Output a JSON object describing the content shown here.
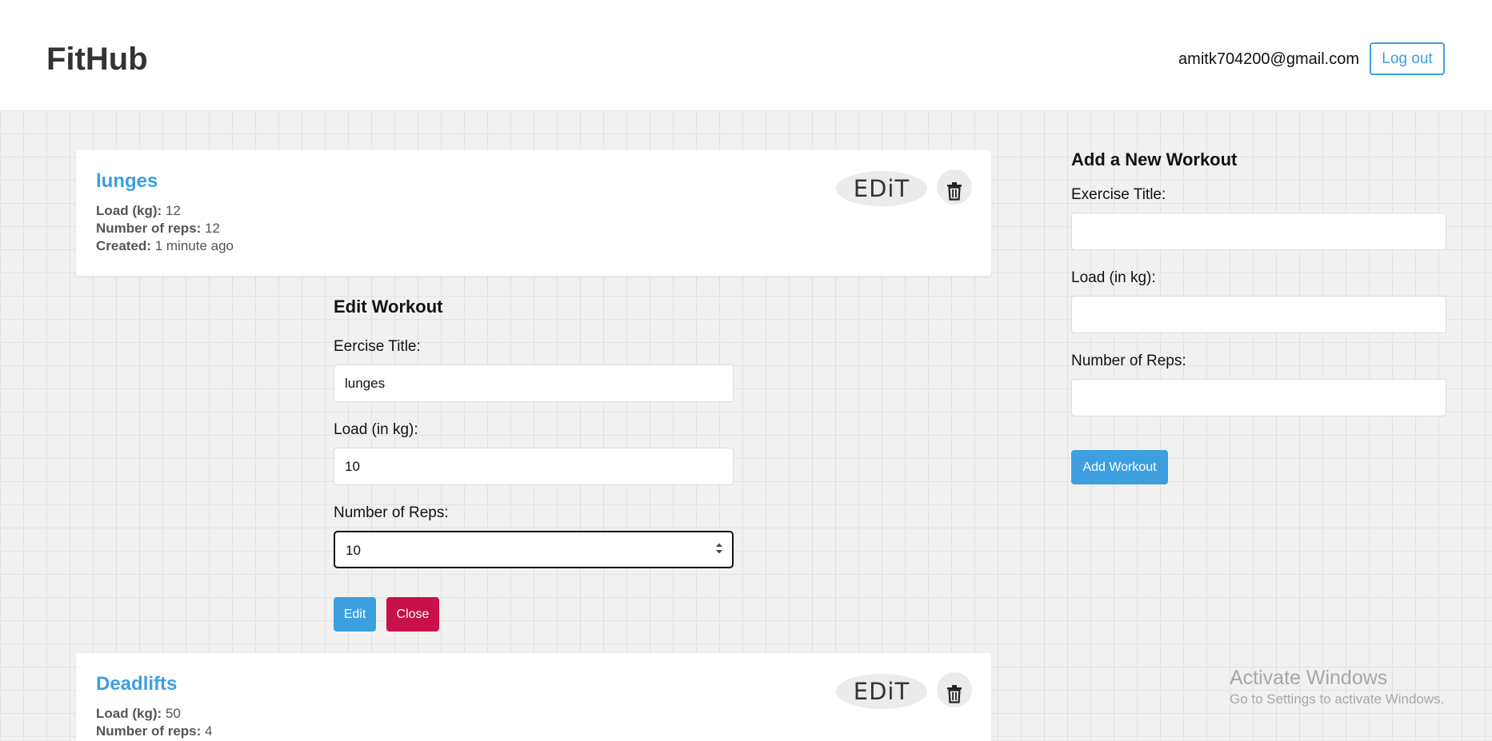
{
  "app": {
    "logo": "FitHub"
  },
  "header": {
    "user_email": "amitk704200@gmail.com",
    "logout_label": "Log out"
  },
  "workouts": [
    {
      "title": "lunges",
      "load_label": "Load (kg):",
      "load_value": "12",
      "reps_label": "Number of reps:",
      "reps_value": "12",
      "created_label": "Created:",
      "created_value": "1 minute ago",
      "edit_label": "EDiT"
    },
    {
      "title": "Deadlifts",
      "load_label": "Load (kg):",
      "load_value": "50",
      "reps_label": "Number of reps:",
      "reps_value": "4",
      "edit_label": "EDiT"
    }
  ],
  "edit_form": {
    "heading": "Edit Workout",
    "title_label": "Eercise Title:",
    "title_value": "lunges",
    "load_label": "Load (in kg):",
    "load_value": "10",
    "reps_label": "Number of Reps:",
    "reps_value": "10",
    "submit_label": "Edit",
    "close_label": "Close"
  },
  "add_form": {
    "heading": "Add a New Workout",
    "title_label": "Exercise Title:",
    "title_value": "",
    "load_label": "Load (in kg):",
    "load_value": "",
    "reps_label": "Number of Reps:",
    "reps_value": "",
    "submit_label": "Add Workout"
  },
  "watermark": {
    "title": "Activate Windows",
    "subtitle": "Go to Settings to activate Windows."
  },
  "colors": {
    "accent": "#3d9fe0",
    "danger": "#c8104a",
    "background": "#f1f1f1"
  }
}
